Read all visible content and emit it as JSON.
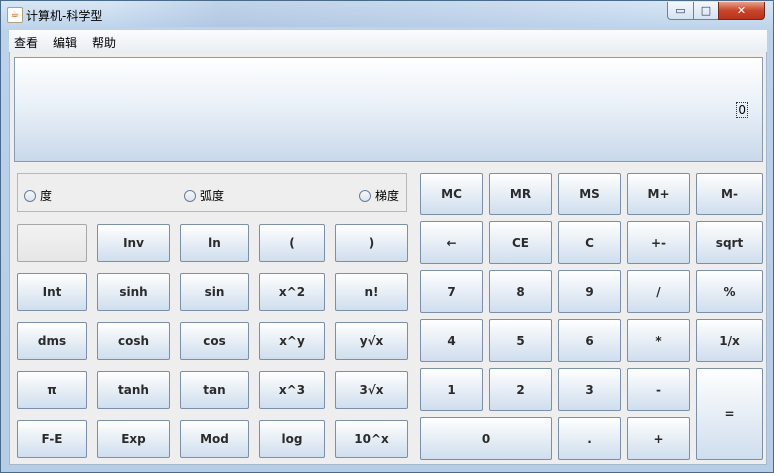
{
  "window": {
    "title": "计算机-科学型",
    "app_icon": "java-coffee-icon",
    "controls": {
      "minimize": "▭",
      "maximize": "□",
      "close": "✕"
    }
  },
  "menu": [
    "查看",
    "编辑",
    "帮助"
  ],
  "display": {
    "value": "0"
  },
  "angle_units": {
    "options": [
      "度",
      "弧度",
      "梯度"
    ],
    "selected": null
  },
  "scientific_buttons": {
    "row1": [
      "",
      "Inv",
      "ln",
      "(",
      ")"
    ],
    "row2": [
      "Int",
      "sinh",
      "sin",
      "x^2",
      "n!"
    ],
    "row3": [
      "dms",
      "cosh",
      "cos",
      "x^y",
      "y√x"
    ],
    "row4": [
      "π",
      "tanh",
      "tan",
      "x^3",
      "3√x"
    ],
    "row5": [
      "F-E",
      "Exp",
      "Mod",
      "log",
      "10^x"
    ]
  },
  "standard_buttons": {
    "row1": [
      "MC",
      "MR",
      "MS",
      "M+",
      "M-"
    ],
    "row2": [
      "←",
      "CE",
      "C",
      "+-",
      "sqrt"
    ],
    "row3": [
      "7",
      "8",
      "9",
      "/",
      "%"
    ],
    "row4": [
      "4",
      "5",
      "6",
      "*",
      "1/x"
    ],
    "row5": [
      "1",
      "2",
      "3",
      "-",
      "="
    ],
    "row6": [
      "0",
      ".",
      "+"
    ]
  },
  "colors": {
    "window_frame": "#b7cde6",
    "client_bg": "#eeeeee",
    "button_border": "#7c8fa8",
    "close_button": "#c8452a"
  }
}
